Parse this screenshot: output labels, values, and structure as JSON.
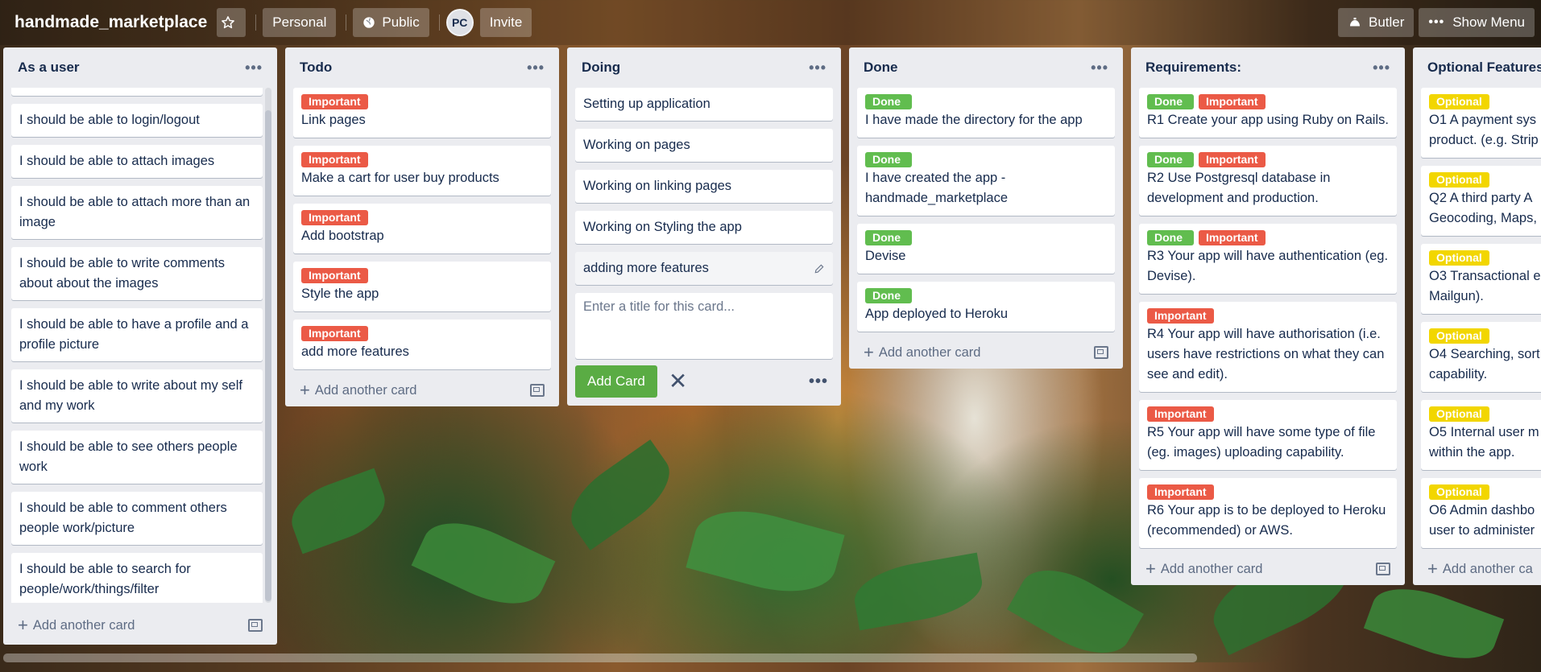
{
  "board": {
    "title": "handmade_marketplace",
    "personal_label": "Personal",
    "visibility_label": "Public",
    "avatar_initials": "PC",
    "invite_label": "Invite",
    "butler_label": "Butler",
    "show_menu_label": "Show Menu"
  },
  "colors": {
    "green": "#61bd4f",
    "red": "#eb5a46",
    "yellow": "#f2d600"
  },
  "lists": {
    "user": {
      "title": "As a user",
      "cards": [
        "I should be able to login/logout",
        "I should be able to attach images",
        "I should be able to attach more than an image",
        "I should be able to write comments about about the images",
        "I should be able to have a profile and a profile picture",
        "I should be able to write about my self and my work",
        "I should be able to see others people work",
        "I should be able to comment others people work/picture",
        "I should be able to search for people/work/things/filter"
      ],
      "add_label": "Add another card"
    },
    "todo": {
      "title": "Todo",
      "label": "Important",
      "cards": [
        "Link pages",
        "Make a cart for user buy products",
        "Add bootstrap",
        "Style the app",
        "add more features"
      ],
      "add_label": "Add another card"
    },
    "doing": {
      "title": "Doing",
      "cards": [
        "Setting up application",
        "Working on pages",
        "Working on linking pages",
        "Working on Styling the app",
        "adding more features"
      ],
      "composer_placeholder": "Enter a title for this card...",
      "add_button": "Add Card"
    },
    "done": {
      "title": "Done",
      "label": "Done",
      "cards": [
        "I have made the directory for the app",
        "I have created the app - handmade_marketplace",
        "Devise",
        "App deployed to Heroku"
      ],
      "add_label": "Add another card"
    },
    "req": {
      "title": "Requirements:",
      "label_done": "Done",
      "label_important": "Important",
      "cards": [
        "R1 Create your app using Ruby on Rails.",
        "R2 Use Postgresql database in development and production.",
        "R3 Your app will have authentication (eg. Devise).",
        "R4 Your app will have authorisation (i.e. users have restrictions on what they can see and edit).",
        "R5 Your app will have some type of file (eg. images) uploading capability.",
        "R6 Your app is to be deployed to Heroku (recommended) or AWS."
      ],
      "add_label": "Add another card"
    },
    "opt": {
      "title": "Optional Features",
      "label": "Optional",
      "cards": [
        "O1 A payment sys product. (e.g. Strip",
        "Q2 A third party A Geocoding, Maps,",
        "O3 Transactional e Mailgun).",
        "O4 Searching, sort capability.",
        "O5 Internal user m within the app.",
        "O6 Admin dashbo user to administer"
      ],
      "add_label": "Add another ca"
    }
  }
}
